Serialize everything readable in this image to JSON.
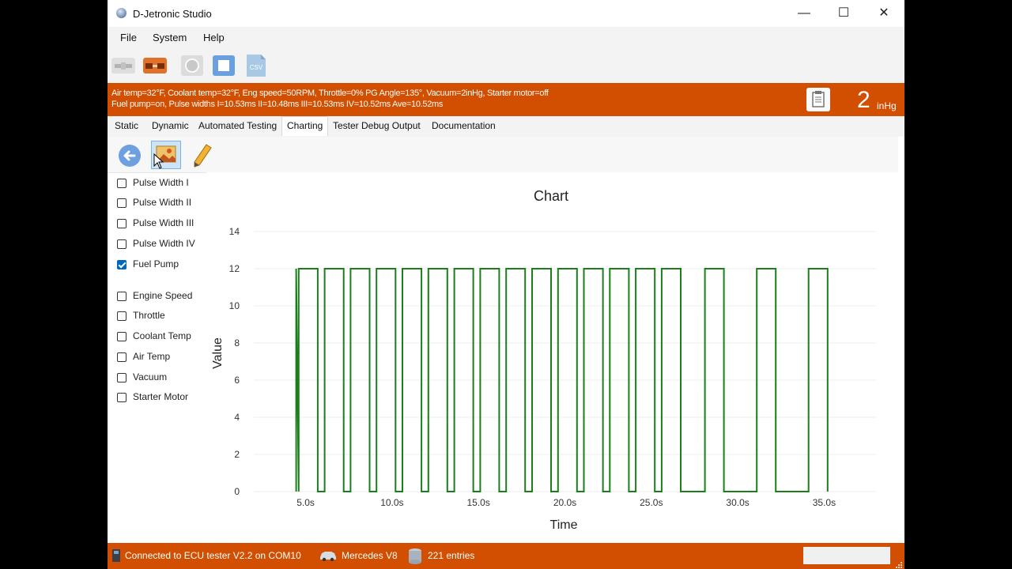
{
  "window": {
    "title": "D-Jetronic Studio",
    "controls": {
      "minimize": "—",
      "maximize": "☐",
      "close": "✕"
    }
  },
  "menu": [
    "File",
    "System",
    "Help"
  ],
  "toolbar": {
    "icons": [
      "disconnect-plug-icon",
      "connect-plug-icon",
      "record-icon",
      "stop-icon",
      "csv-export-icon"
    ],
    "csv_label": "CSV"
  },
  "status_banner": {
    "line1": "Air temp=32°F, Coolant temp=32°F, Eng speed=50RPM, Throttle=0% PG Angle=135°, Vacuum=2inHg, Starter motor=off",
    "line2": "Fuel pump=on, Pulse widths I=10.53ms II=10.48ms III=10.53ms IV=10.52ms Ave=10.52ms",
    "vacuum_value": "2",
    "vacuum_unit": "inHg",
    "color": "#d24e00"
  },
  "tabs": [
    {
      "label": "Static",
      "active": false
    },
    {
      "label": "Dynamic",
      "active": false
    },
    {
      "label": "Automated Testing",
      "active": false
    },
    {
      "label": "Charting",
      "active": true
    },
    {
      "label": "Tester Debug Output",
      "active": false
    },
    {
      "label": "Documentation",
      "active": false
    }
  ],
  "chart_toolbar": {
    "icons": [
      "back-arrow-icon",
      "save-image-icon",
      "pencil-icon"
    ]
  },
  "series_checkboxes": [
    {
      "label": "Pulse Width I",
      "checked": false
    },
    {
      "label": "Pulse Width II",
      "checked": false
    },
    {
      "label": "Pulse Width III",
      "checked": false
    },
    {
      "label": "Pulse Width IV",
      "checked": false
    },
    {
      "label": "Fuel Pump",
      "checked": true
    },
    {
      "label": "Engine Speed",
      "checked": false
    },
    {
      "label": "Throttle",
      "checked": false
    },
    {
      "label": "Coolant Temp",
      "checked": false
    },
    {
      "label": "Air Temp",
      "checked": false
    },
    {
      "label": "Vacuum",
      "checked": false
    },
    {
      "label": "Starter Motor",
      "checked": false
    }
  ],
  "chart_data": {
    "type": "line",
    "title": "Chart",
    "xlabel": "Time",
    "ylabel": "Value",
    "xlim": [
      2.0,
      38.0
    ],
    "ylim": [
      0,
      14
    ],
    "x_ticks": [
      5,
      10,
      15,
      20,
      25,
      30,
      35
    ],
    "x_tick_labels": [
      "5.0s",
      "10.0s",
      "15.0s",
      "20.0s",
      "25.0s",
      "30.0s",
      "35.0s"
    ],
    "y_ticks": [
      0,
      2,
      4,
      6,
      8,
      10,
      12,
      14
    ],
    "grid": true,
    "legend": "none",
    "series": [
      {
        "color": "#1a7f1a",
        "x": [
          4.45,
          4.45,
          4.6,
          4.6,
          5.7,
          5.7,
          6.1,
          6.1,
          7.2,
          7.2,
          7.6,
          7.6,
          8.7,
          8.7,
          9.1,
          9.1,
          10.2,
          10.2,
          10.6,
          10.6,
          11.7,
          11.7,
          12.1,
          12.1,
          13.2,
          13.2,
          13.6,
          13.6,
          14.7,
          14.7,
          15.1,
          15.1,
          16.2,
          16.2,
          16.6,
          16.6,
          17.7,
          17.7,
          18.1,
          18.1,
          19.2,
          19.2,
          19.6,
          19.6,
          20.7,
          20.7,
          21.1,
          21.1,
          22.2,
          22.2,
          22.6,
          22.6,
          23.7,
          23.7,
          24.1,
          24.1,
          25.2,
          25.2,
          25.6,
          25.6,
          26.7,
          26.7,
          28.1,
          28.1,
          29.2,
          29.2,
          31.1,
          31.1,
          32.2,
          32.2,
          34.1,
          34.1,
          35.2,
          35.2
        ],
        "y": [
          0,
          12,
          0,
          12,
          12,
          0,
          0,
          12,
          12,
          0,
          0,
          12,
          12,
          0,
          0,
          12,
          12,
          0,
          0,
          12,
          12,
          0,
          0,
          12,
          12,
          0,
          0,
          12,
          12,
          0,
          0,
          12,
          12,
          0,
          0,
          12,
          12,
          0,
          0,
          12,
          12,
          0,
          0,
          12,
          12,
          0,
          0,
          12,
          12,
          0,
          0,
          12,
          12,
          0,
          0,
          12,
          12,
          0,
          0,
          12,
          12,
          0,
          0,
          12,
          12,
          0,
          0,
          12,
          12,
          0,
          0,
          12,
          12,
          0
        ]
      }
    ]
  },
  "statusbar": {
    "connection": "Connected to ECU tester V2.2 on COM10",
    "vehicle": "Mercedes V8",
    "entries": "221 entries",
    "color": "#d24e00"
  }
}
